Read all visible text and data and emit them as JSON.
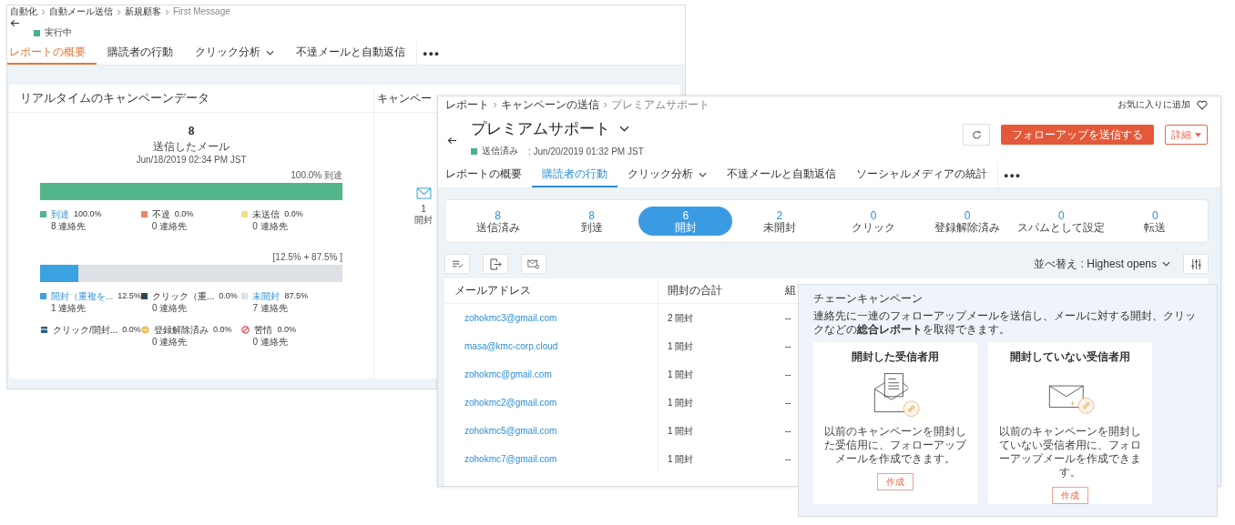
{
  "back_window": {
    "breadcrumb": [
      "自動化",
      "自動メール送信",
      "新規顧客",
      "First Message"
    ],
    "status": "実行中",
    "tabs": [
      {
        "label": "レポートの概要",
        "selected": true,
        "dropdown": false
      },
      {
        "label": "購読者の行動",
        "selected": false,
        "dropdown": false
      },
      {
        "label": "クリック分析",
        "selected": false,
        "dropdown": true
      },
      {
        "label": "不達メールと自動返信",
        "selected": false,
        "dropdown": false
      }
    ],
    "more": "●●●",
    "panel_title": "リアルタイムのキャンペーンデータ",
    "side_panel_title": "キャンペー",
    "sent": {
      "count": "8",
      "label": "送信したメール",
      "date": "Jun/18/2019 02:34 PM JST"
    },
    "delivery": {
      "caption": "100.0% 到達",
      "bar": {
        "level": 1,
        "color": "#52b68c"
      },
      "legend": [
        {
          "kind": "square",
          "label": "到達",
          "value": "100.0%",
          "contacts": "8 連絡先",
          "color": "#52b68c",
          "link": true
        },
        {
          "kind": "square",
          "label": "不達",
          "value": "0.0%",
          "contacts": "0 連絡先",
          "color": "#e8876a",
          "link": false
        },
        {
          "kind": "square",
          "label": "未送信",
          "value": "0.0%",
          "contacts": "0 連絡先",
          "color": "#f2e08a",
          "link": false
        }
      ]
    },
    "opens": {
      "caption": "[12.5% + 87.5% ]",
      "bar": {
        "level": 0.125,
        "color": "#3aa2e0"
      },
      "legend": [
        {
          "kind": "square",
          "label": "開封（重複を...",
          "value": "12.5%",
          "contacts": "1 連絡先",
          "color": "#3aa2e0",
          "link": true
        },
        {
          "kind": "square",
          "label": "クリック（重...",
          "value": "0.0%",
          "contacts": "0 連絡先",
          "color": "#2f4555",
          "link": false
        },
        {
          "kind": "square",
          "label": "未開封",
          "value": "87.5%",
          "contacts": "7 連絡先",
          "color": "#dde1e5",
          "link": true
        },
        {
          "kind": "stack",
          "label": "クリック/開封...",
          "value": "0.0%",
          "color": "#2a5e86",
          "link": false
        },
        {
          "kind": "unsubscribe",
          "label": "登録解除済み",
          "value": "0.0%",
          "contacts": "0 連絡先",
          "color": "#e8c15a",
          "link": false
        },
        {
          "kind": "complaint",
          "label": "苦情",
          "value": "0.0%",
          "contacts": "0 連絡先",
          "color": "#d9434b",
          "link": false
        }
      ]
    },
    "reach": {
      "count": "1",
      "label": "開封"
    }
  },
  "front_window": {
    "breadcrumb": [
      "レポート",
      "キャンペーンの送信",
      "プレミアムサポート"
    ],
    "favorite": "お気に入りに追加",
    "title": "プレミアムサポート",
    "status": "送信済み",
    "date": ": Jun/20/2019 01:32 PM JST",
    "follow_up_button": "フォローアップを送信する",
    "details_button": "詳細",
    "tabs": [
      {
        "label": "レポートの概要",
        "selected": false,
        "dropdown": false
      },
      {
        "label": "購読者の行動",
        "selected": true,
        "dropdown": false
      },
      {
        "label": "クリック分析",
        "selected": false,
        "dropdown": true
      },
      {
        "label": "不達メールと自動返信",
        "selected": false,
        "dropdown": false
      },
      {
        "label": "ソーシャルメディアの統計",
        "selected": false,
        "dropdown": false
      }
    ],
    "more": "●●●",
    "stats": [
      {
        "value": "8",
        "label": "送信済み",
        "selected": false
      },
      {
        "value": "8",
        "label": "到達",
        "selected": false
      },
      {
        "value": "6",
        "label": "開封",
        "selected": true
      },
      {
        "value": "2",
        "label": "未開封",
        "selected": false
      },
      {
        "value": "0",
        "label": "クリック",
        "selected": false
      },
      {
        "value": "0",
        "label": "登録解除済み",
        "selected": false
      },
      {
        "value": "0",
        "label": "スパムとして設定",
        "selected": false
      },
      {
        "value": "0",
        "label": "転送",
        "selected": false
      }
    ],
    "sort": "並べ替え : Highest opens",
    "table": {
      "columns": [
        "メールアドレス",
        "開封の合計",
        "組"
      ],
      "rows": [
        {
          "email": "zohokmc3@gmail.com",
          "opens": "2 開封",
          "column_3": "--"
        },
        {
          "email": "masa@kmc-corp.cloud",
          "opens": "1 開封",
          "column_3": "--"
        },
        {
          "email": "zohokmc@gmail.com",
          "opens": "1 開封",
          "column_3": "--"
        },
        {
          "email": "zohokmc2@gmail.com",
          "opens": "1 開封",
          "column_3": "--"
        },
        {
          "email": "zohokmc5@gmail.com",
          "opens": "1 開封",
          "column_3": "--"
        },
        {
          "email": "zohokmc7@gmail.com",
          "opens": "1 開封",
          "column_3": "--"
        }
      ]
    }
  },
  "chain_panel": {
    "title": "チェーンキャンペーン",
    "description": "連絡先に一連のフォローアップメールを送信し、メールに対する開封、クリックなどの**総合レポート**を取得できます。",
    "cards": [
      {
        "kind": "opened",
        "title": "開封した受信者用",
        "description": "以前のキャンペーンを開封した受信用に、フォローアップメールを作成できます。",
        "button": "作成"
      },
      {
        "kind": "unopened",
        "title": "開封していない受信者用",
        "description": "以前のキャンペーンを開封していない受信者用に、フォローアップメールを作成できます。",
        "button": "作成"
      }
    ]
  }
}
